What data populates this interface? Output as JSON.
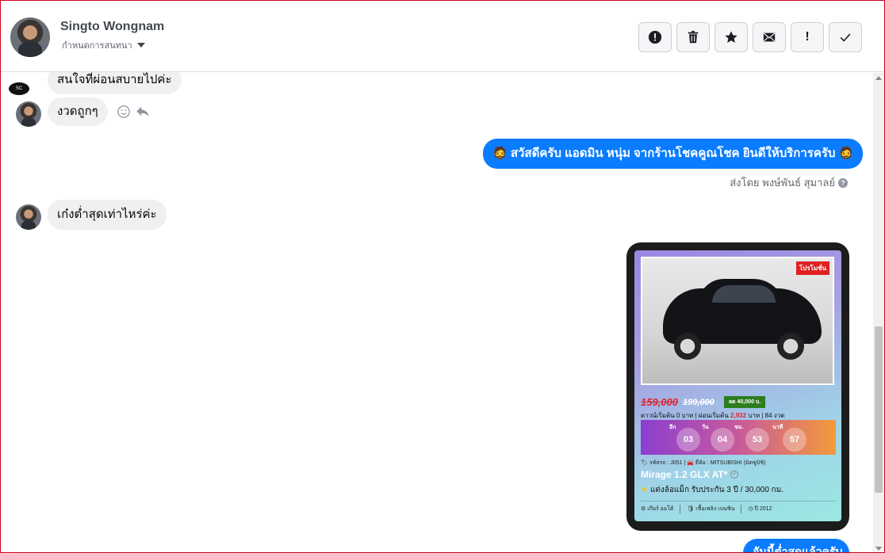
{
  "header": {
    "name": "Singto Wongnam",
    "subtitle": "กำหนดการสนทนา",
    "actions": [
      {
        "icon": "alert-circle-icon"
      },
      {
        "icon": "trash-icon"
      },
      {
        "icon": "star-icon"
      },
      {
        "icon": "envelope-icon"
      },
      {
        "icon": "exclamation-icon",
        "glyph": "!"
      },
      {
        "icon": "check-icon"
      }
    ]
  },
  "messages": {
    "m1": "สนใจที่ผ่อนสบายไปค่ะ",
    "m2": "งวดถูกๆ",
    "m3": "🧔 สวัสดีครับ แอดมิน หนุ่ม จากร้านโชคคูณโชค ยินดีให้บริการครับ 🧔",
    "sent_by": "ส่งโดย พงษ์พันธ์ สุมาลย์",
    "m4": "เก๋งต่ำสุดเท่าไหร่ค่ะ",
    "peek": "อันนี้ต่ำสุดแล้วครับ"
  },
  "logo_text": "SC",
  "card": {
    "promo": "โปรโมชั่น",
    "price": "159,000",
    "old_price": "199,000",
    "discount": "ลด 40,000 บ.",
    "down_prefix": "ดาวน์เริ่มต้น 0 บาท | ผ่อนเริ่มต้น",
    "monthly": "2,932",
    "down_suffix": "บาท | 84 งวด",
    "countdown_labels": [
      "อีก",
      "วัน",
      "ชม.",
      "นาที"
    ],
    "countdown": [
      "03",
      "04",
      "53",
      "57"
    ],
    "tags": "🏷 รหัสรถ : J051 | 🚘 ยี่ห้อ : MITSUBISHI (มิตซูบิชิ)",
    "model": "Mirage 1.2 GLX AT*",
    "feature": "แต่งล้อแม็ก รับประกัน 3 ปี / 30,000 กม.",
    "specs": [
      "⚙ เกียร์ ออโต้",
      "🛢 เชื้อเพลิง เบนซิน",
      "◷ ปี 2012"
    ]
  }
}
